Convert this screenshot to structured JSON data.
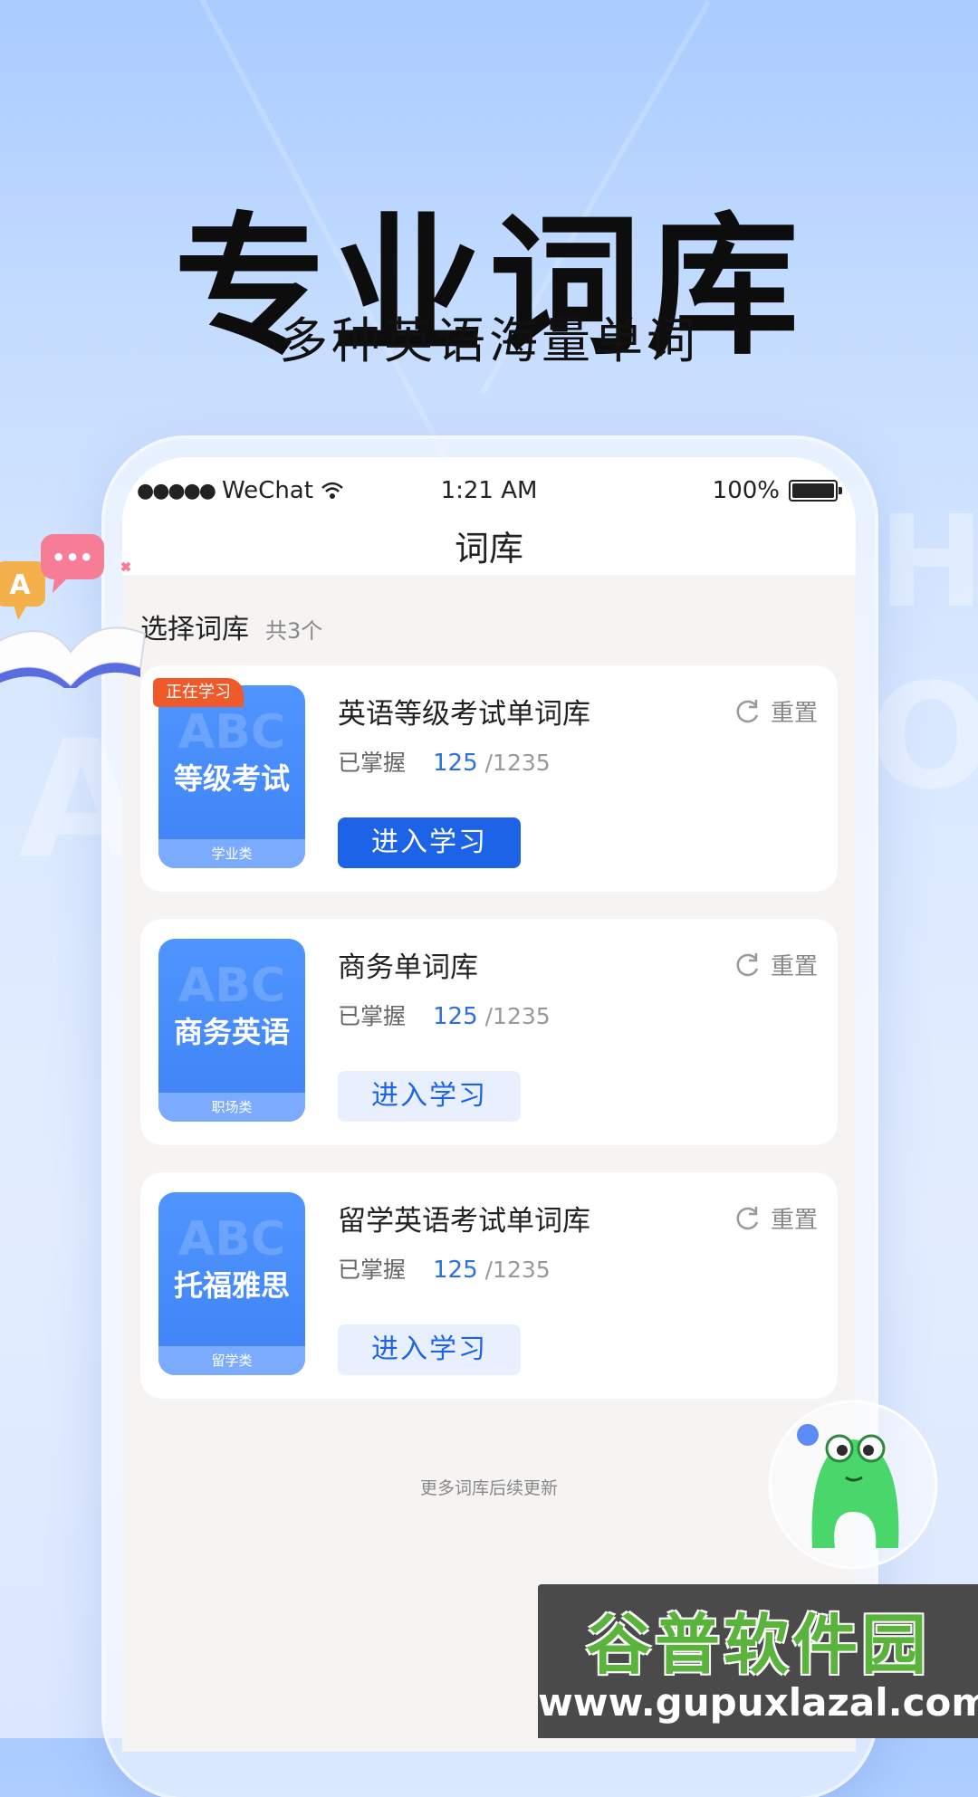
{
  "hero": {
    "title": "专业词库",
    "subtitle": "多种英语海量单词"
  },
  "status_bar": {
    "carrier": "WeChat",
    "signal_dots": "●●●●●",
    "time": "1:21 AM",
    "battery_percent": "100%"
  },
  "nav": {
    "title": "词库"
  },
  "section": {
    "title": "选择词库",
    "count": "共3个"
  },
  "cards": [
    {
      "tag": "正在学习",
      "cover_title": "等级考试",
      "cover_abc": "ABC",
      "cover_category": "学业类",
      "name": "英语等级考试单词库",
      "mastered_label": "已掌握",
      "mastered": "125",
      "total": "/1235",
      "reset_label": "重置",
      "button_label": "进入学习",
      "active": true
    },
    {
      "cover_title": "商务英语",
      "cover_abc": "ABC",
      "cover_category": "职场类",
      "name": "商务单词库",
      "mastered_label": "已掌握",
      "mastered": "125",
      "total": "/1235",
      "reset_label": "重置",
      "button_label": "进入学习",
      "active": false
    },
    {
      "cover_title": "托福雅思",
      "cover_abc": "ABC",
      "cover_category": "留学类",
      "name": "留学英语考试单词库",
      "mastered_label": "已掌握",
      "mastered": "125",
      "total": "/1235",
      "reset_label": "重置",
      "button_label": "进入学习",
      "active": false
    }
  ],
  "footer_note": "更多词库后续更新",
  "decor": {
    "book_letter": "A",
    "book_bubble": "•••"
  },
  "watermark": {
    "title": "谷普软件园",
    "url": "www.gupuxlazal.com"
  },
  "colors": {
    "primary": "#1d63e8",
    "tag": "#f05a2a",
    "cover": "#4f95ff"
  }
}
